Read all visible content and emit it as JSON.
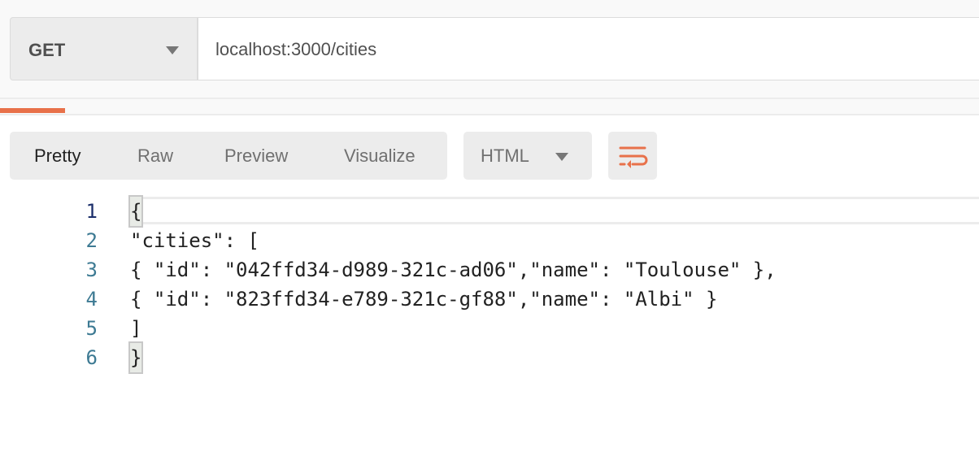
{
  "request": {
    "method": "GET",
    "url": "localhost:3000/cities"
  },
  "response": {
    "tabs": [
      "Pretty",
      "Raw",
      "Preview",
      "Visualize"
    ],
    "active_tab": "Pretty",
    "format": "HTML",
    "accent_color": "#e8714a",
    "lines": [
      {
        "num": "1",
        "open": "{",
        "text": ""
      },
      {
        "num": "2",
        "text": "\"cities\": ["
      },
      {
        "num": "3",
        "text": "{ \"id\": \"042ffd34-d989-321c-ad06\",\"name\": \"Toulouse\" },"
      },
      {
        "num": "4",
        "text": "{ \"id\": \"823ffd34-e789-321c-gf88\",\"name\": \"Albi\" }"
      },
      {
        "num": "5",
        "text": "]"
      },
      {
        "num": "6",
        "open": "}",
        "text": ""
      }
    ]
  }
}
